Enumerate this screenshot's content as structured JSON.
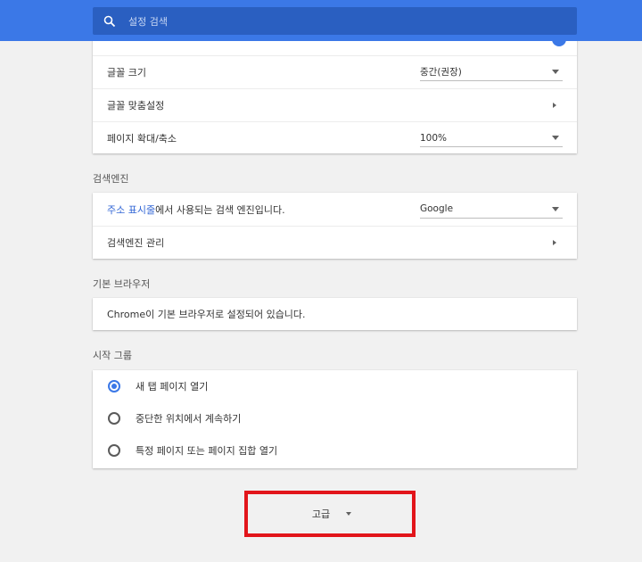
{
  "header": {
    "search_placeholder": "설정 검색",
    "accent_color": "#3b78e7"
  },
  "appearance": {
    "rows": [
      {
        "label": "글꼴 크기",
        "value": "중간(권장)"
      },
      {
        "label": "글꼴 맞춤설정"
      },
      {
        "label": "페이지 확대/축소",
        "value": "100%"
      }
    ]
  },
  "search_engine": {
    "title": "검색엔진",
    "row1": {
      "link": "주소 표시줄",
      "suffix": "에서 사용되는 검색 엔진입니다.",
      "value": "Google"
    },
    "row2": {
      "label": "검색엔진 관리"
    }
  },
  "default_browser": {
    "title": "기본 브라우저",
    "text": "Chrome이 기본 브라우저로 설정되어 있습니다."
  },
  "on_startup": {
    "title": "시작 그룹",
    "options": [
      {
        "label": "새 탭 페이지 열기",
        "checked": true
      },
      {
        "label": "중단한 위치에서 계속하기",
        "checked": false
      },
      {
        "label": "특정 페이지 또는 페이지 집합 열기",
        "checked": false
      }
    ]
  },
  "advanced": {
    "label": "고급",
    "highlight_color": "#e2151b"
  }
}
